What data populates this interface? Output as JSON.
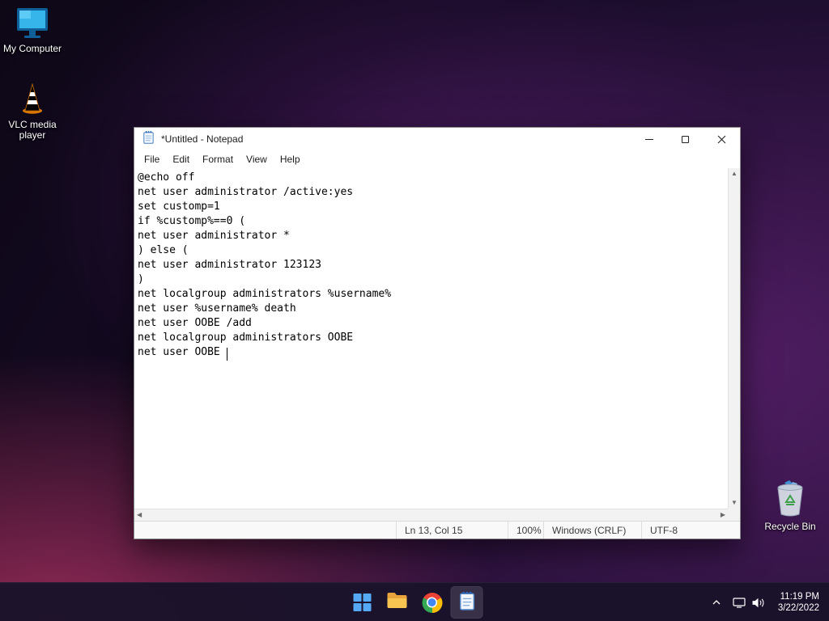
{
  "desktop": {
    "icons": {
      "my_computer": {
        "label": "My Computer"
      },
      "vlc": {
        "label": "VLC media player"
      },
      "recycle_bin": {
        "label": "Recycle Bin"
      }
    }
  },
  "notepad": {
    "title": "*Untitled - Notepad",
    "menus": {
      "file": "File",
      "edit": "Edit",
      "format": "Format",
      "view": "View",
      "help": "Help"
    },
    "lines": [
      "@echo off",
      "net user administrator /active:yes",
      "set customp=1",
      "if %customp%==0 (",
      "net user administrator *",
      ") else (",
      "net user administrator 123123",
      ")",
      "net localgroup administrators %username%",
      "net user %username% death",
      "net user OOBE /add",
      "net localgroup administrators OOBE",
      "net user OOBE "
    ],
    "status": {
      "cursor": "Ln 13, Col 15",
      "zoom": "100%",
      "eol": "Windows (CRLF)",
      "encoding": "UTF-8"
    },
    "scrollbar": {
      "up": "▲",
      "down": "▼",
      "left": "◀",
      "right": "▶"
    }
  },
  "taskbar": {
    "clock": {
      "time": "11:19 PM",
      "date": "3/22/2022"
    }
  }
}
